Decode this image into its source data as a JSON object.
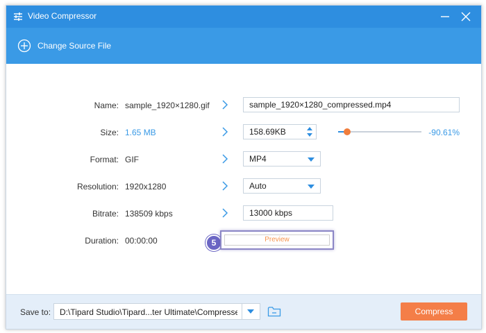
{
  "window": {
    "title": "Video Compressor"
  },
  "toolbar": {
    "change_source_label": "Change Source File"
  },
  "fields": {
    "name": {
      "label": "Name:",
      "source": "sample_1920×1280.gif",
      "output": "sample_1920×1280_compressed.mp4"
    },
    "size": {
      "label": "Size:",
      "source": "1.65 MB",
      "output": "158.69KB",
      "percent": "-90.61%",
      "slider_fraction": 0.11
    },
    "format": {
      "label": "Format:",
      "source": "GIF",
      "output": "MP4"
    },
    "resolution": {
      "label": "Resolution:",
      "source": "1920x1280",
      "output": "Auto"
    },
    "bitrate": {
      "label": "Bitrate:",
      "source": "138509 kbps",
      "output": "13000 kbps"
    },
    "duration": {
      "label": "Duration:",
      "source": "00:00:00"
    }
  },
  "preview": {
    "label": "Preview",
    "step_number": "5"
  },
  "footer": {
    "save_to_label": "Save to:",
    "path": "D:\\Tipard Studio\\Tipard...ter Ultimate\\Compressed",
    "compress_label": "Compress"
  },
  "colors": {
    "titlebar": "#2e8ee0",
    "toolbar": "#3a9ae6",
    "accent_blue": "#3a9ae6",
    "compress_orange": "#f47e48",
    "slider_thumb": "#f07d3c",
    "step_badge": "#6b66c4"
  },
  "icons": {
    "app": "sliders-icon",
    "minimize": "minimize-icon",
    "close": "close-icon",
    "change_source": "plus-circle-icon",
    "arrow": "chevron-right-icon",
    "dropdown": "caret-down-icon",
    "folder": "folder-icon"
  }
}
